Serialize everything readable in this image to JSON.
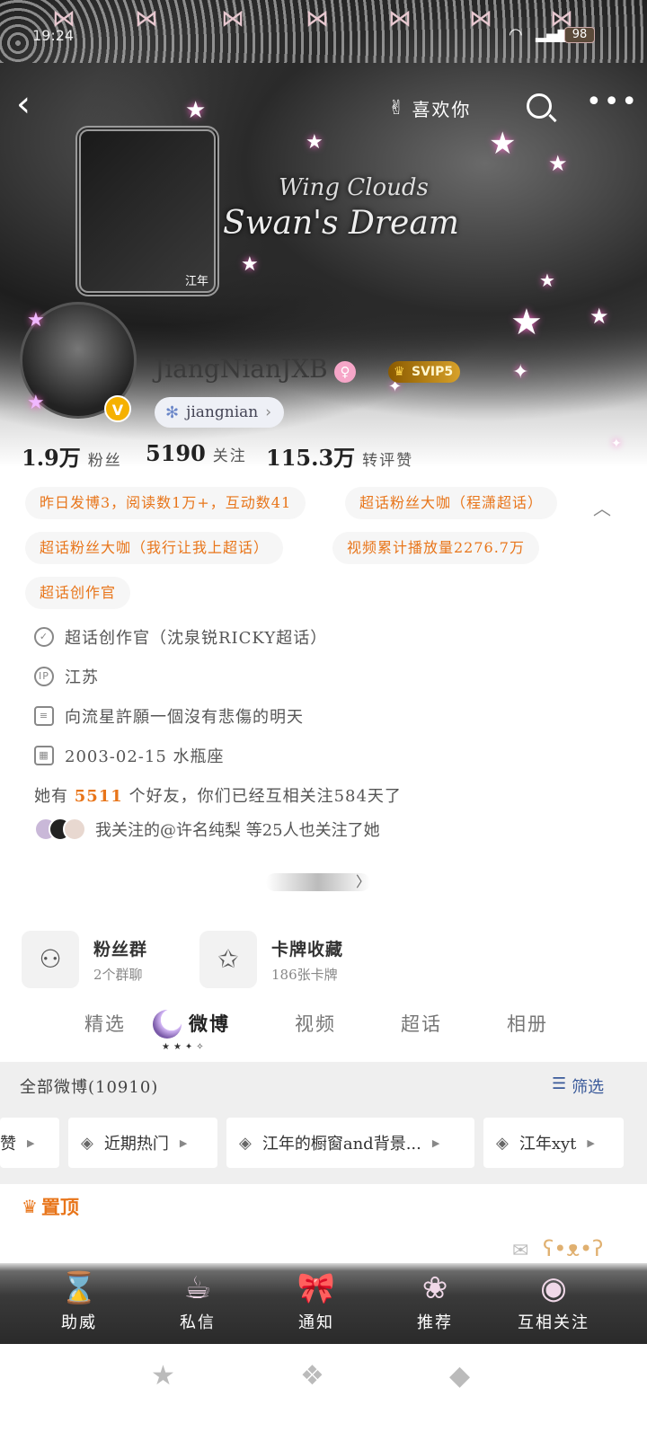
{
  "status_bar": {
    "time": "19:24",
    "battery": "98"
  },
  "header": {
    "like_label": "喜欢你"
  },
  "banner": {
    "title": "Wing Clouds",
    "subtitle": "Swan's Dream",
    "frame_label": "江年"
  },
  "profile": {
    "username": "JiangNianJXB",
    "badge": "SVIP5",
    "verified_mark": "V",
    "gender_mark": "♀",
    "handle": "jiangnian",
    "handle_arrow": "›"
  },
  "stats": [
    {
      "value": "1.9万",
      "label": "粉丝"
    },
    {
      "value": "5190",
      "label": "关注"
    },
    {
      "value": "115.3万",
      "label": "转评赞"
    }
  ],
  "tags": [
    "昨日发博3，阅读数1万+，互动数41",
    "超话粉丝大咖（程潇超话）",
    "超话粉丝大咖（我行让我上超话）",
    "视频累计播放量2276.7万",
    "超话创作官"
  ],
  "info": {
    "creator": "超话创作官（沈泉锐RICKY超话）",
    "ip": "江苏",
    "bio": "向流星許願一個沒有悲傷的明天",
    "birthday": "2003-02-15 水瓶座",
    "ip_icon": "IP"
  },
  "friends": {
    "prefix": "她有",
    "count": "5511",
    "suffix": "个好友，你们已经互相关注584天了"
  },
  "mutual": "我关注的@许名纯梨 等25人也关注了她",
  "cards": [
    {
      "title": "粉丝群",
      "subtitle": "2个群聊"
    },
    {
      "title": "卡牌收藏",
      "subtitle": "186张卡牌"
    }
  ],
  "tabs": [
    "精选",
    "微博",
    "视频",
    "超话",
    "相册"
  ],
  "feed": {
    "title": "全部微博(10910)",
    "filter": "筛选"
  },
  "chips": [
    "赞",
    "近期热门",
    "江年的橱窗and背景...",
    "江年xyt"
  ],
  "pinned": "置顶",
  "action_bar": [
    "助威",
    "私信",
    "通知",
    "推荐",
    "互相关注"
  ],
  "colors": {
    "accent": "#e8751a",
    "link": "#3a5a9a",
    "gold": "#f5b100"
  }
}
